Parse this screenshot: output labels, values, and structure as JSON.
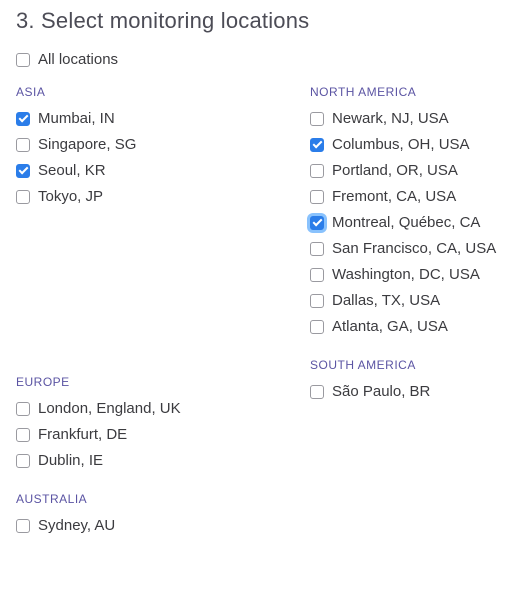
{
  "title": "3. Select monitoring locations",
  "all_locations_label": "All locations",
  "all_locations_checked": false,
  "left_column": [
    {
      "name": "ASIA",
      "locations": [
        {
          "label": "Mumbai, IN",
          "checked": true,
          "focused": false
        },
        {
          "label": "Singapore, SG",
          "checked": false,
          "focused": false
        },
        {
          "label": "Seoul, KR",
          "checked": true,
          "focused": false
        },
        {
          "label": "Tokyo, JP",
          "checked": false,
          "focused": false
        }
      ]
    },
    {
      "name": "EUROPE",
      "locations": [
        {
          "label": "London, England, UK",
          "checked": false,
          "focused": false
        },
        {
          "label": "Frankfurt, DE",
          "checked": false,
          "focused": false
        },
        {
          "label": "Dublin, IE",
          "checked": false,
          "focused": false
        }
      ]
    },
    {
      "name": "AUSTRALIA",
      "locations": [
        {
          "label": "Sydney, AU",
          "checked": false,
          "focused": false
        }
      ]
    }
  ],
  "right_column": [
    {
      "name": "NORTH AMERICA",
      "locations": [
        {
          "label": "Newark, NJ, USA",
          "checked": false,
          "focused": false
        },
        {
          "label": "Columbus, OH, USA",
          "checked": true,
          "focused": false
        },
        {
          "label": "Portland, OR, USA",
          "checked": false,
          "focused": false
        },
        {
          "label": "Fremont, CA, USA",
          "checked": false,
          "focused": false
        },
        {
          "label": "Montreal, Québec, CA",
          "checked": true,
          "focused": true
        },
        {
          "label": "San Francisco, CA, USA",
          "checked": false,
          "focused": false
        },
        {
          "label": "Washington, DC, USA",
          "checked": false,
          "focused": false
        },
        {
          "label": "Dallas, TX, USA",
          "checked": false,
          "focused": false
        },
        {
          "label": "Atlanta, GA, USA",
          "checked": false,
          "focused": false
        }
      ]
    },
    {
      "name": "SOUTH AMERICA",
      "locations": [
        {
          "label": "São Paulo, BR",
          "checked": false,
          "focused": false
        }
      ]
    }
  ]
}
